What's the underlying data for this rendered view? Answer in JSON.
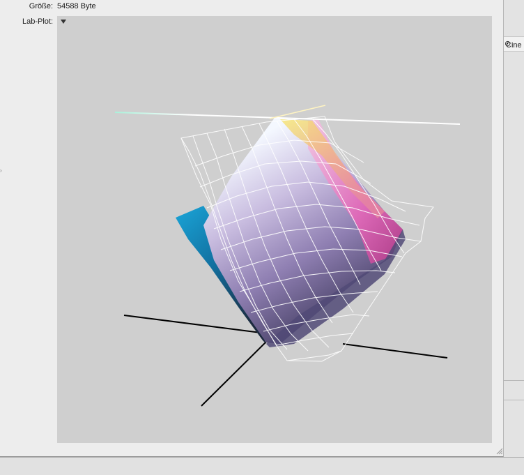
{
  "info": {
    "size_label": "Größe:",
    "size_value": "54588 Byte",
    "plot_label": "Lab-Plot:"
  },
  "background_window": {
    "partial_label": "Cine",
    "partial_icon": "radio-icon"
  },
  "plot": {
    "background_color": "#cfcfcf",
    "axis_color": "#000000",
    "wireframe_color": "#ffffff",
    "popup_icon": "triangle-down-icon"
  }
}
